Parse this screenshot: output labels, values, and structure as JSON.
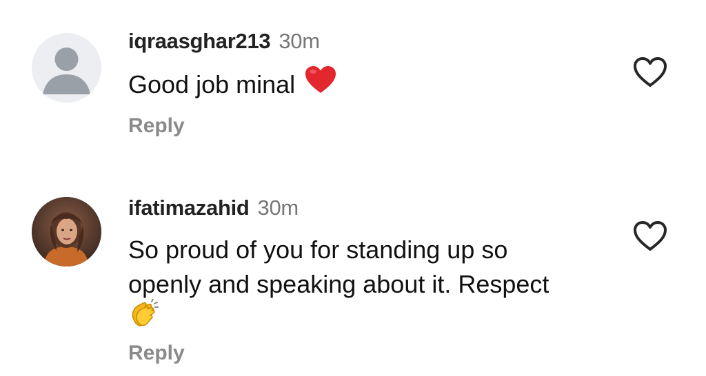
{
  "comments": [
    {
      "username": "iqraasghar213",
      "time": "30m",
      "text": "Good job minal",
      "emoji": "heart-emoji",
      "reply_label": "Reply",
      "avatar": "default-avatar-icon",
      "like_icon": "heart-outline-icon"
    },
    {
      "username": "ifatimazahid",
      "time": "30m",
      "text_lines": [
        "So proud of you for standing up so",
        "openly and speaking about it. Respect"
      ],
      "emoji": "clapping-hands-emoji",
      "reply_label": "Reply",
      "avatar": "profile-photo",
      "like_icon": "heart-outline-icon"
    }
  ],
  "colors": {
    "username": "#222222",
    "timestamp": "#777777",
    "reply": "#8a8a8a",
    "heart_emoji": "#e3272f",
    "like_outline": "#262626",
    "default_avatar_bg": "#eceef1",
    "default_avatar_fg": "#9aa0a8"
  }
}
